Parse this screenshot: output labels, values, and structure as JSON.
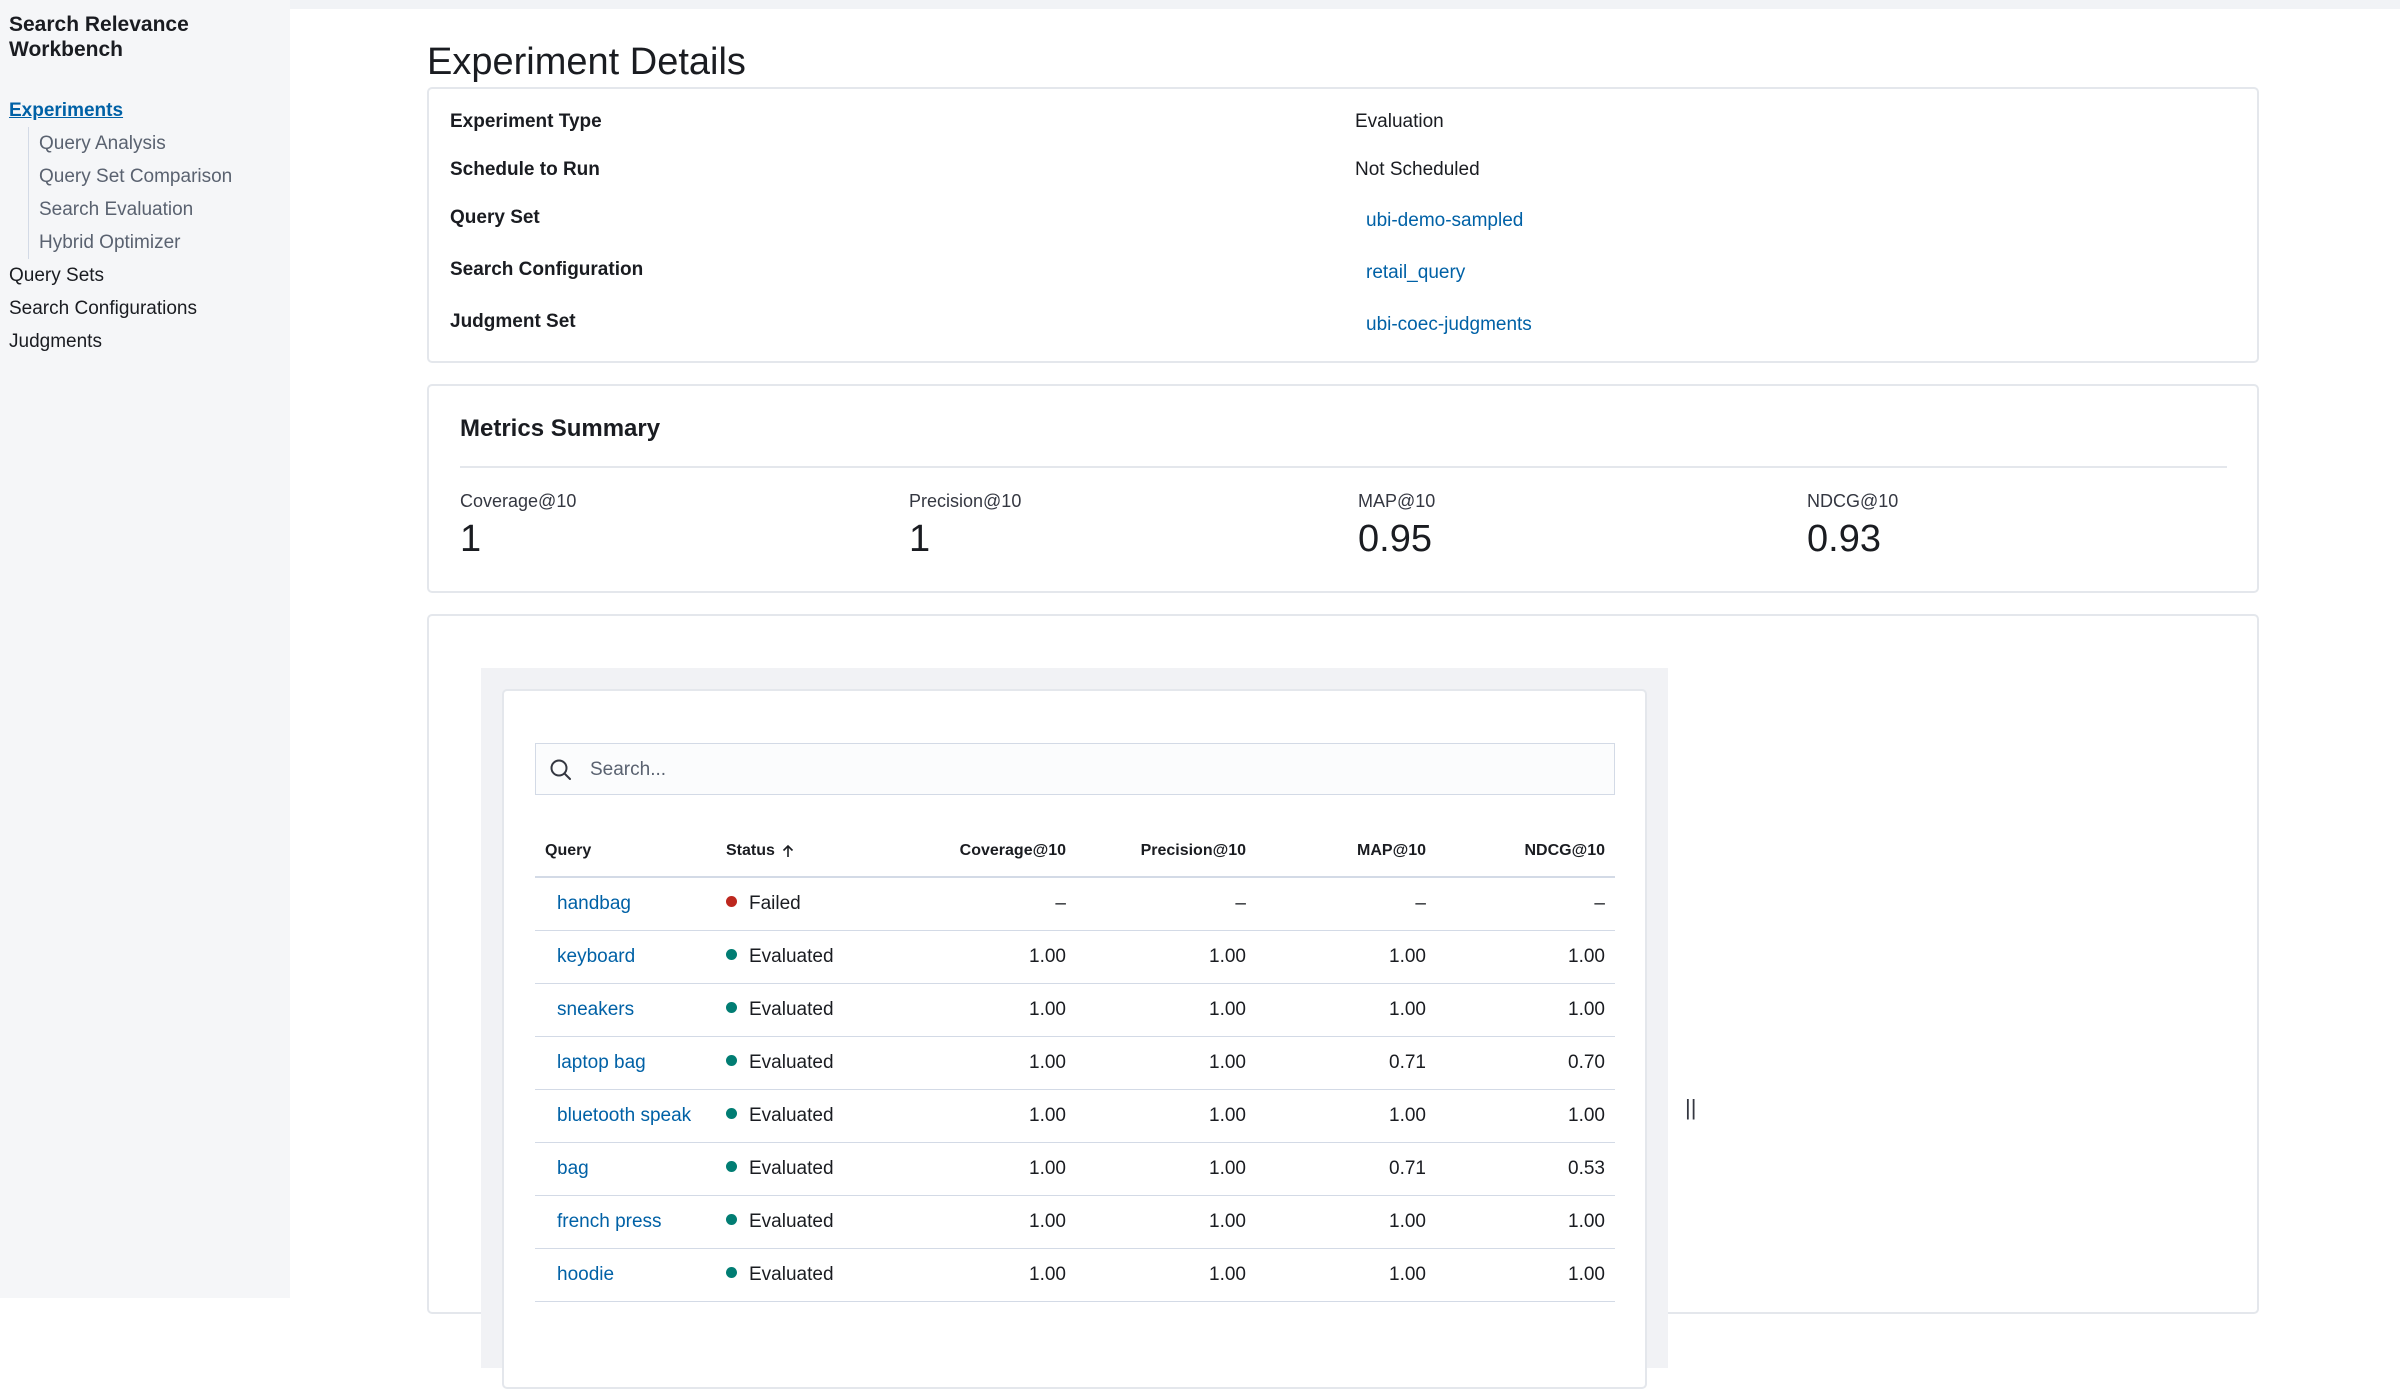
{
  "sidebar": {
    "app_title": "Search Relevance Workbench",
    "items": [
      {
        "label": "Experiments",
        "active": true
      },
      {
        "label": "Query Analysis",
        "sub": true
      },
      {
        "label": "Query Set Comparison",
        "sub": true
      },
      {
        "label": "Search Evaluation",
        "sub": true
      },
      {
        "label": "Hybrid Optimizer",
        "sub": true
      },
      {
        "label": "Query Sets"
      },
      {
        "label": "Search Configurations"
      },
      {
        "label": "Judgments"
      }
    ]
  },
  "page": {
    "title": "Experiment Details"
  },
  "details": [
    {
      "label": "Experiment Type",
      "value": "Evaluation",
      "link": false
    },
    {
      "label": "Schedule to Run",
      "value": "Not Scheduled",
      "link": false
    },
    {
      "label": "Query Set",
      "value": "ubi-demo-sampled",
      "link": true
    },
    {
      "label": "Search Configuration",
      "value": "retail_query",
      "link": true
    },
    {
      "label": "Judgment Set",
      "value": "ubi-coec-judgments",
      "link": true
    }
  ],
  "metrics": {
    "title": "Metrics Summary",
    "items": [
      {
        "label": "Coverage@10",
        "value": "1"
      },
      {
        "label": "Precision@10",
        "value": "1"
      },
      {
        "label": "MAP@10",
        "value": "0.95"
      },
      {
        "label": "NDCG@10",
        "value": "0.93"
      }
    ]
  },
  "results": {
    "search_placeholder": "Search...",
    "columns": {
      "query": "Query",
      "status": "Status",
      "coverage": "Coverage@10",
      "precision": "Precision@10",
      "map": "MAP@10",
      "ndcg": "NDCG@10"
    },
    "rows": [
      {
        "query": "handbag",
        "status": "Failed",
        "coverage": "–",
        "precision": "–",
        "map": "–",
        "ndcg": "–"
      },
      {
        "query": "keyboard",
        "status": "Evaluated",
        "coverage": "1.00",
        "precision": "1.00",
        "map": "1.00",
        "ndcg": "1.00"
      },
      {
        "query": "sneakers",
        "status": "Evaluated",
        "coverage": "1.00",
        "precision": "1.00",
        "map": "1.00",
        "ndcg": "1.00"
      },
      {
        "query": "laptop bag",
        "status": "Evaluated",
        "coverage": "1.00",
        "precision": "1.00",
        "map": "0.71",
        "ndcg": "0.70"
      },
      {
        "query": "bluetooth speak",
        "status": "Evaluated",
        "coverage": "1.00",
        "precision": "1.00",
        "map": "1.00",
        "ndcg": "1.00"
      },
      {
        "query": "bag",
        "status": "Evaluated",
        "coverage": "1.00",
        "precision": "1.00",
        "map": "0.71",
        "ndcg": "0.53"
      },
      {
        "query": "french press",
        "status": "Evaluated",
        "coverage": "1.00",
        "precision": "1.00",
        "map": "1.00",
        "ndcg": "1.00"
      },
      {
        "query": "hoodie",
        "status": "Evaluated",
        "coverage": "1.00",
        "precision": "1.00",
        "map": "1.00",
        "ndcg": "1.00"
      }
    ],
    "resize_handle": "||"
  },
  "colors": {
    "link": "#0061a6",
    "status_failed": "#bd271e",
    "status_evaluated": "#017d73",
    "sidebar_bg": "#f5f6f8",
    "border": "#e4e7ec"
  }
}
